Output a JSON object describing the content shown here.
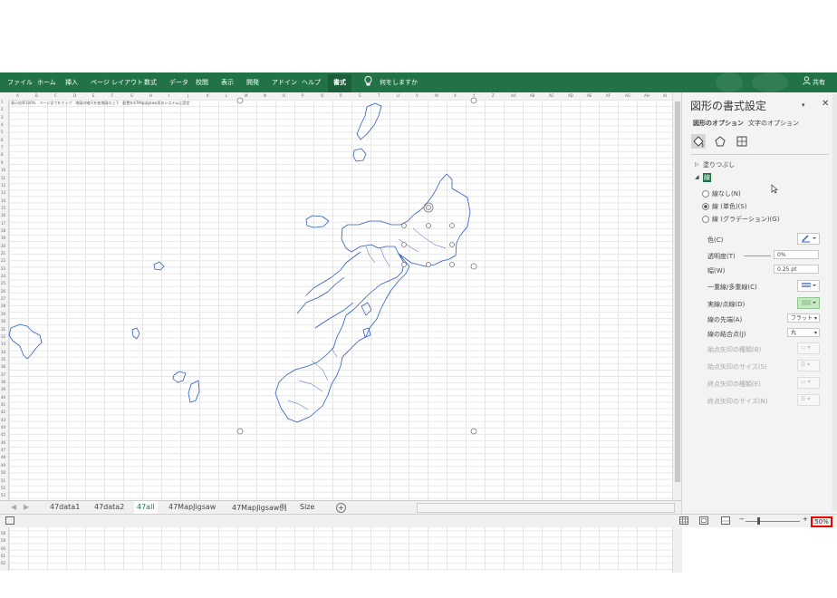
{
  "ribbon": {
    "tabs": [
      "ファイル",
      "ホーム",
      "挿入",
      "ページ レイアウト",
      "数式",
      "データ",
      "校閲",
      "表示",
      "開発",
      "アドイン",
      "ヘルプ"
    ],
    "active_tab": "書式",
    "tell_me": "何をしますか",
    "share": "共有",
    "color": "#217346"
  },
  "sheet": {
    "columns": [
      "A",
      "B",
      "C",
      "D",
      "E",
      "F",
      "G",
      "H",
      "I",
      "J",
      "K",
      "L",
      "M",
      "N",
      "O",
      "P",
      "Q",
      "R",
      "S",
      "T",
      "U",
      "V",
      "W",
      "X",
      "Y",
      "Z",
      "AA",
      "AB",
      "AC",
      "AD",
      "AE",
      "AF",
      "AG",
      "AH",
      "AI"
    ],
    "row_count": 62,
    "a1_text": "表示倍率100%　ページ全てをマップ　地図の縮尺を各地図の上下　配置を47MapJigsaw用のシステムに設定",
    "outline_color": "#2b5cc4"
  },
  "sheet_tabs": {
    "items": [
      "47data1",
      "47data2",
      "47all",
      "47MapJigsaw",
      "47MapJigsaw例",
      "Size"
    ],
    "active": "47all",
    "add_label": "+"
  },
  "pane": {
    "title": "図形の書式設定",
    "tab_shape": "図形のオプション",
    "tab_text": "文字のオプション",
    "fill_section": "塗りつぶし",
    "line_section": "線",
    "radio_none": "線なし(N)",
    "radio_solid": "線 (単色)(S)",
    "radio_gradient": "線 (グラデーション)(G)",
    "color_label": "色(C)",
    "transparency_label": "透明度(T)",
    "transparency_value": "0%",
    "width_label": "幅(W)",
    "width_value": "0.25 pt",
    "compound_label": "一重線/多重線(C)",
    "dash_label": "実線/点線(D)",
    "cap_label": "線の先端(A)",
    "cap_value": "フラット",
    "join_label": "線の結合点(J)",
    "join_value": "丸",
    "begin_arrow_type": "始点矢印の種類(B)",
    "begin_arrow_size": "始点矢印のサイズ(S)",
    "end_arrow_type": "終点矢印の種類(E)",
    "end_arrow_size": "終点矢印のサイズ(N)"
  },
  "status": {
    "zoom_percent": "50%",
    "zoom_minus": "−",
    "zoom_plus": "+"
  },
  "icons": [
    "lightbulb-icon",
    "person-icon",
    "fill-line-icon",
    "pentagon-icon",
    "size-properties-icon",
    "close-icon",
    "dropdown-arrow-icon",
    "cursor-icon"
  ]
}
